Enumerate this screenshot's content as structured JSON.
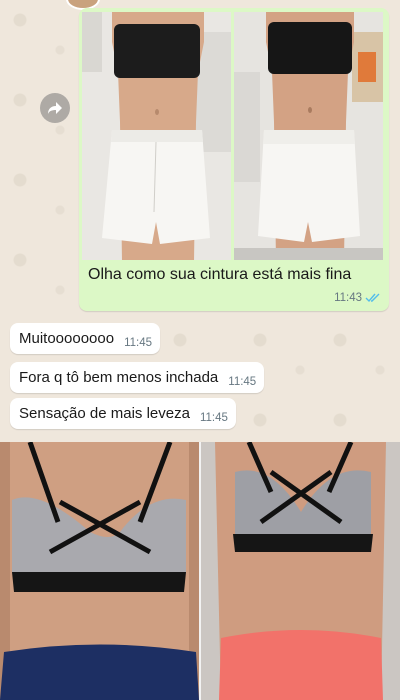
{
  "chat": {
    "outgoing": {
      "text": "Olha como sua cintura está mais fina",
      "time": "11:43",
      "status_icon": "double-check-icon"
    },
    "incoming": [
      {
        "text": "Muitoooooooo",
        "time": "11:45"
      },
      {
        "text": "Fora q tô bem menos inchada",
        "time": "11:45"
      },
      {
        "text": "Sensação de mais leveza",
        "time": "11:45"
      }
    ],
    "forward_icon": "forward-arrow-icon"
  },
  "colors": {
    "outgoing_bubble": "#dcf8c6",
    "incoming_bubble": "#ffffff",
    "chat_background": "#efe7dc",
    "timestamp": "#667781",
    "read_ticks": "#53bdeb"
  }
}
